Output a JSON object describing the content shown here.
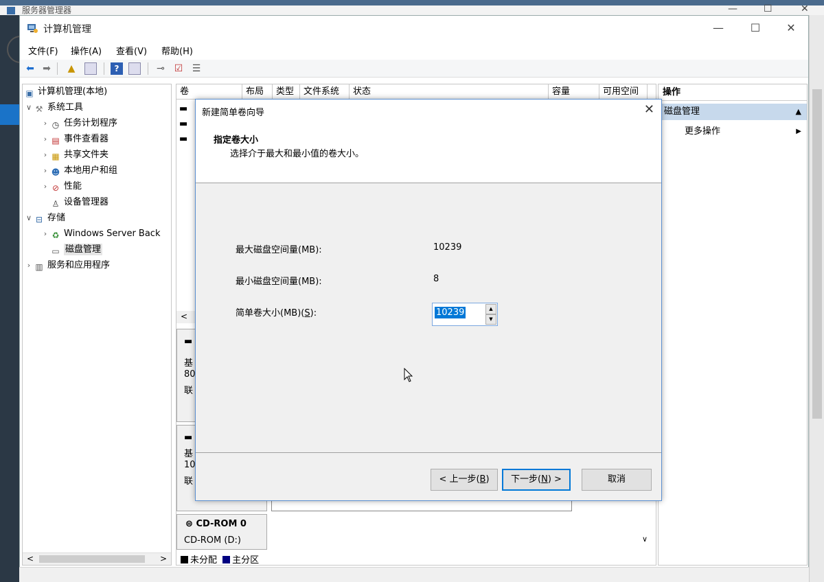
{
  "background": {
    "title": "服务器管理器"
  },
  "window": {
    "title": "计算机管理",
    "minimize": "—",
    "maximize": "☐",
    "close": "✕"
  },
  "menu": [
    "文件(F)",
    "操作(A)",
    "查看(V)",
    "帮助(H)"
  ],
  "tree": {
    "root": "计算机管理(本地)",
    "system_tools": "系统工具",
    "task_scheduler": "任务计划程序",
    "event_viewer": "事件查看器",
    "shared_folders": "共享文件夹",
    "local_users": "本地用户和组",
    "performance": "性能",
    "device_manager": "设备管理器",
    "storage": "存储",
    "windows_backup": "Windows Server Back",
    "disk_management": "磁盘管理",
    "services_apps": "服务和应用程序"
  },
  "columns": [
    "卷",
    "布局",
    "类型",
    "文件系统",
    "状态",
    "容量",
    "可用空间"
  ],
  "disks": {
    "d1": [
      "基",
      "80",
      "联"
    ],
    "d2": [
      "基",
      "10",
      "联"
    ],
    "cdrom_title": "CD-ROM 0",
    "cdrom_sub": "CD-ROM (D:)"
  },
  "legend": {
    "unallocated": "未分配",
    "primary": "主分区",
    "unallocated_color": "#000000",
    "primary_color": "#000080"
  },
  "actions": {
    "header": "操作",
    "section": "磁盘管理",
    "more": "更多操作"
  },
  "dialog": {
    "title": "新建简单卷向导",
    "heading": "指定卷大小",
    "subheading": "选择介于最大和最小值的卷大小。",
    "max_label": "最大磁盘空间量(MB):",
    "max_value": "10239",
    "min_label": "最小磁盘空间量(MB):",
    "min_value": "8",
    "size_label_pre": "简单卷大小(MB)(",
    "size_label_key": "S",
    "size_label_post": "):",
    "size_value": "10239",
    "back_pre": "< 上一步(",
    "back_key": "B",
    "back_post": ")",
    "next_pre": "下一步(",
    "next_key": "N",
    "next_post": ") >",
    "cancel": "取消"
  }
}
